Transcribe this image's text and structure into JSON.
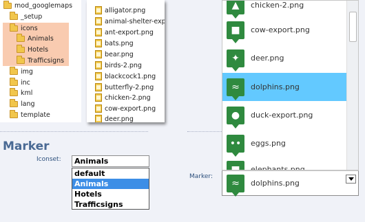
{
  "tree": {
    "root": "mod_googlemaps",
    "items": [
      "_setup",
      "icons",
      "Animals",
      "Hotels",
      "Trafficsigns",
      "img",
      "inc",
      "kml",
      "lang",
      "template"
    ]
  },
  "files": {
    "items": [
      "alligator.png",
      "animal-shelter-exp...",
      "ant-export.png",
      "bats.png",
      "bear.png",
      "birds-2.png",
      "blackcock1.png",
      "butterfly-2.png",
      "chicken-2.png",
      "cow-export.png",
      "deer.png"
    ]
  },
  "marker": {
    "title": "Marker",
    "iconset_label": "Iconset:",
    "iconset_value": "Animals",
    "iconset_options": [
      "default",
      "Animals",
      "Hotels",
      "Trafficsigns"
    ],
    "marker_label": "Marker:",
    "marker_value": "dolphins.png",
    "marker_options": [
      "chicken-2.png",
      "cow-export.png",
      "deer.png",
      "dolphins.png",
      "duck-export.png",
      "eggs.png",
      "elephants.png"
    ],
    "selected_color": "#63c9ff"
  }
}
